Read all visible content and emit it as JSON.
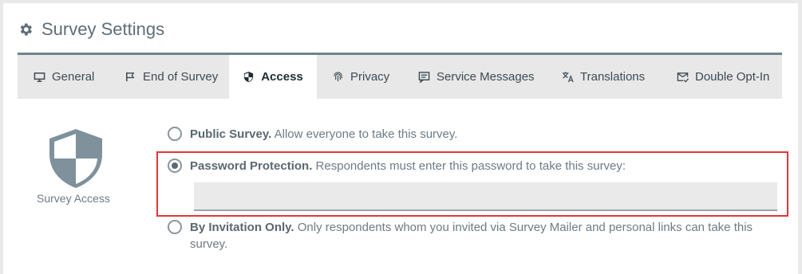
{
  "header": {
    "title": "Survey Settings",
    "icon": "gear-icon"
  },
  "tabs": [
    {
      "label": "General",
      "icon": "monitor-icon"
    },
    {
      "label": "End of Survey",
      "icon": "flag-icon"
    },
    {
      "label": "Access",
      "icon": "shield-icon",
      "active": true
    },
    {
      "label": "Privacy",
      "icon": "fingerprint-icon"
    },
    {
      "label": "Service Messages",
      "icon": "message-icon"
    },
    {
      "label": "Translations",
      "icon": "translate-icon"
    },
    {
      "label": "Double Opt-In",
      "icon": "mail-check-icon"
    }
  ],
  "access": {
    "label": "Survey Access",
    "options": [
      {
        "title": "Public Survey.",
        "description": "Allow everyone to take this survey.",
        "checked": false
      },
      {
        "title": "Password Protection.",
        "description": "Respondents must enter this password to take this survey:",
        "checked": true
      },
      {
        "title": "By Invitation Only.",
        "description": "Only respondents whom you invited via Survey Mailer and personal links can take this survey.",
        "checked": false
      }
    ],
    "password_value": ""
  },
  "colors": {
    "accent": "#6e838e",
    "highlight": "#e2363b"
  }
}
